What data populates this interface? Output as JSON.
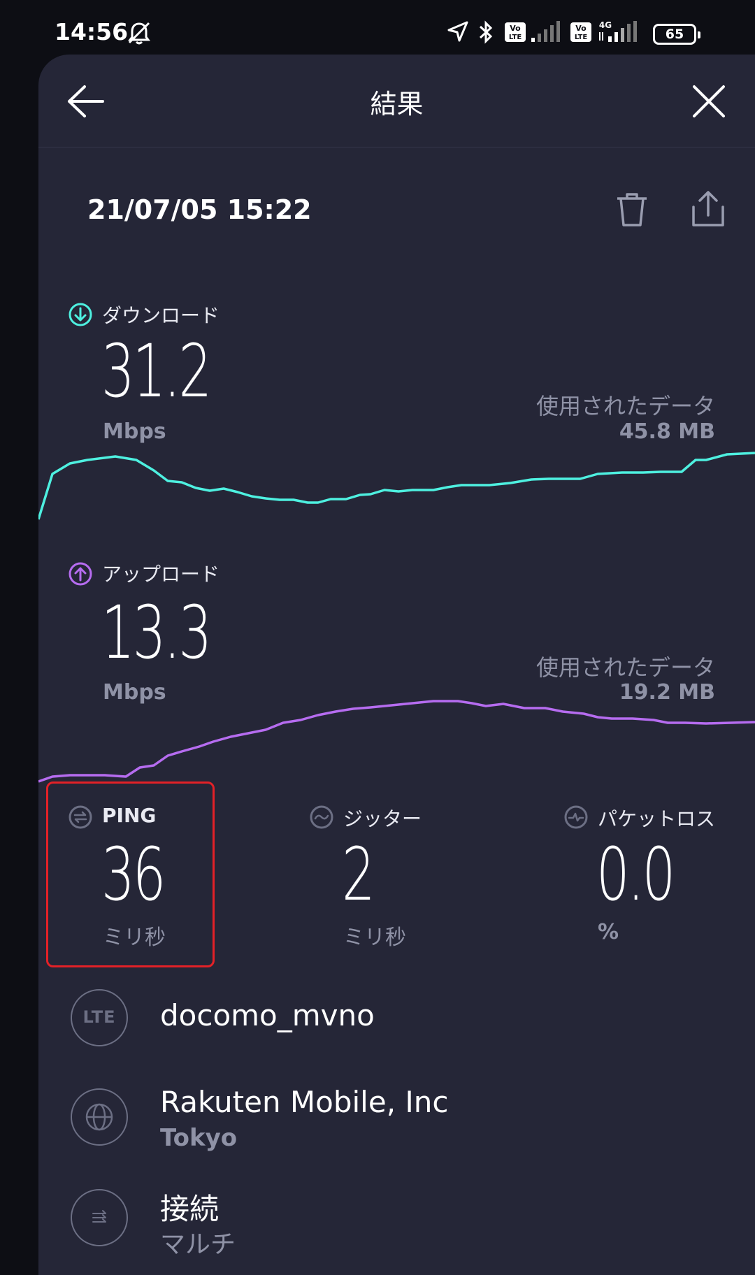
{
  "status_bar": {
    "time": "14:56",
    "battery": "65"
  },
  "header": {
    "title": "結果"
  },
  "result": {
    "datetime": "21/07/05 15:22"
  },
  "download": {
    "label": "ダウンロード",
    "value": "31.2",
    "unit": "Mbps",
    "data_label": "使用されたデータ",
    "data_value": "45.8 MB",
    "color": "#4ef0e0"
  },
  "upload": {
    "label": "アップロード",
    "value": "13.3",
    "unit": "Mbps",
    "data_label": "使用されたデータ",
    "data_value": "19.2 MB",
    "color": "#b66cf0"
  },
  "ping": {
    "label": "PING",
    "value": "36",
    "unit": "ミリ秒"
  },
  "jitter": {
    "label": "ジッター",
    "value": "2",
    "unit": "ミリ秒"
  },
  "packet_loss": {
    "label": "パケットロス",
    "value": "0.0",
    "unit": "%"
  },
  "connection_info": [
    {
      "icon": "LTE",
      "title": "docomo_mvno",
      "sub": ""
    },
    {
      "icon": "globe-icon",
      "title": "Rakuten Mobile, Inc",
      "sub": "Tokyo"
    },
    {
      "icon": "multi-connection-icon",
      "title": "接続",
      "sub": "マルチ"
    }
  ],
  "accent_colors": {
    "highlight_box": "#e32127",
    "background": "#252637"
  }
}
